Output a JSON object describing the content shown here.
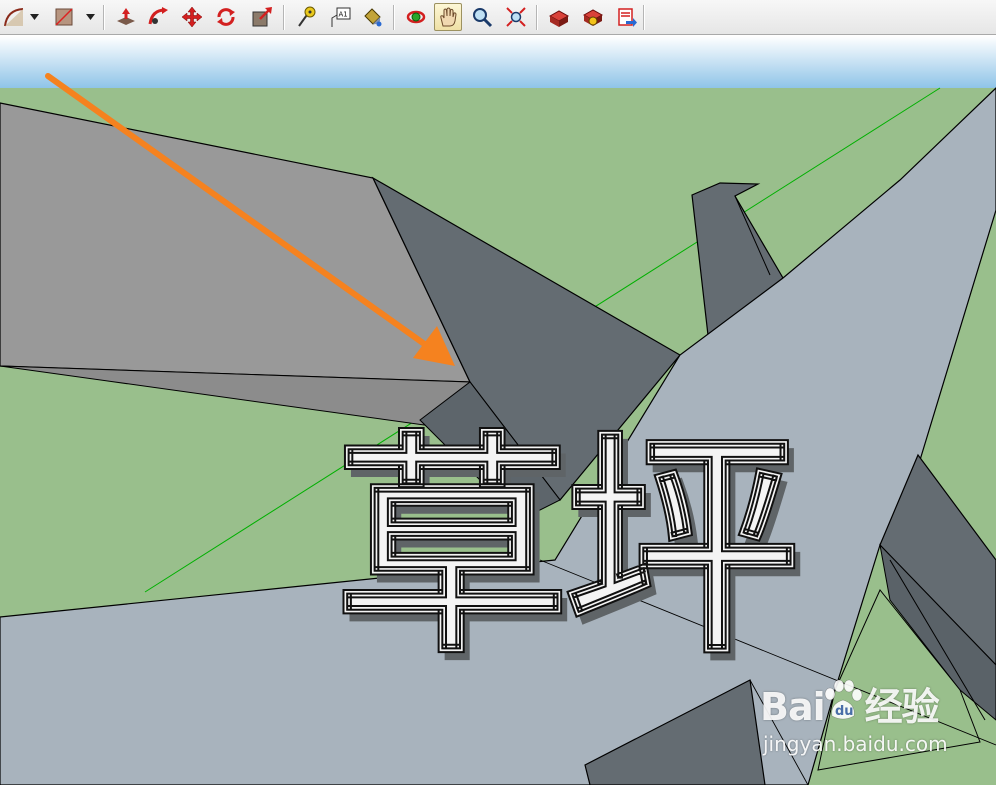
{
  "toolbar": {
    "tools": [
      {
        "id": "arc",
        "icon": "arc-icon",
        "has_dropdown": true
      },
      {
        "id": "shape",
        "icon": "shape-icon",
        "has_dropdown": true
      },
      {
        "id": "push-pull",
        "icon": "push-pull-icon"
      },
      {
        "id": "follow-me",
        "icon": "follow-me-icon"
      },
      {
        "id": "move",
        "icon": "move-icon"
      },
      {
        "id": "rotate",
        "icon": "rotate-icon"
      },
      {
        "id": "scale",
        "icon": "scale-icon"
      },
      {
        "id": "tape-measure",
        "icon": "tape-measure-icon"
      },
      {
        "id": "text",
        "icon": "text-icon",
        "label": "A1"
      },
      {
        "id": "paint-bucket",
        "icon": "paint-bucket-icon"
      },
      {
        "id": "orbit",
        "icon": "orbit-icon"
      },
      {
        "id": "pan",
        "icon": "pan-hand-icon",
        "active": true
      },
      {
        "id": "zoom",
        "icon": "zoom-icon"
      },
      {
        "id": "zoom-extents",
        "icon": "zoom-extents-icon"
      },
      {
        "id": "warehouse",
        "icon": "3d-warehouse-icon"
      },
      {
        "id": "extension-warehouse",
        "icon": "extension-warehouse-icon"
      },
      {
        "id": "send-to-layout",
        "icon": "send-to-layout-icon"
      }
    ]
  },
  "scene": {
    "text_3d": "草坪",
    "colors": {
      "sky_top": "#ffffff",
      "sky_bottom": "#8fc4e8",
      "grass": "#99bf8c",
      "face_light": "#a8b3bd",
      "face_dark": "#646c72",
      "face_gray": "#999999",
      "arrow": "#f5821f",
      "green_axis": "#00b000"
    }
  },
  "watermark": {
    "logo_left": "Bai",
    "logo_right": "经验",
    "url": "jingyan.baidu.com"
  }
}
